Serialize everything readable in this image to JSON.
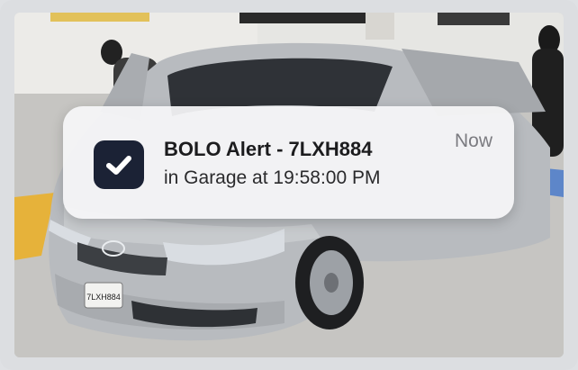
{
  "notification": {
    "app_icon": "checkmark-icon",
    "title": "BOLO Alert - 7LXH884",
    "body": "in Garage at 19:58:00 PM",
    "time": "Now"
  },
  "background": {
    "plate_text": "7LXH884",
    "colors": {
      "car": "#b9bcc0",
      "floor": "#c9c8c5",
      "accent": "#1b2235"
    }
  }
}
